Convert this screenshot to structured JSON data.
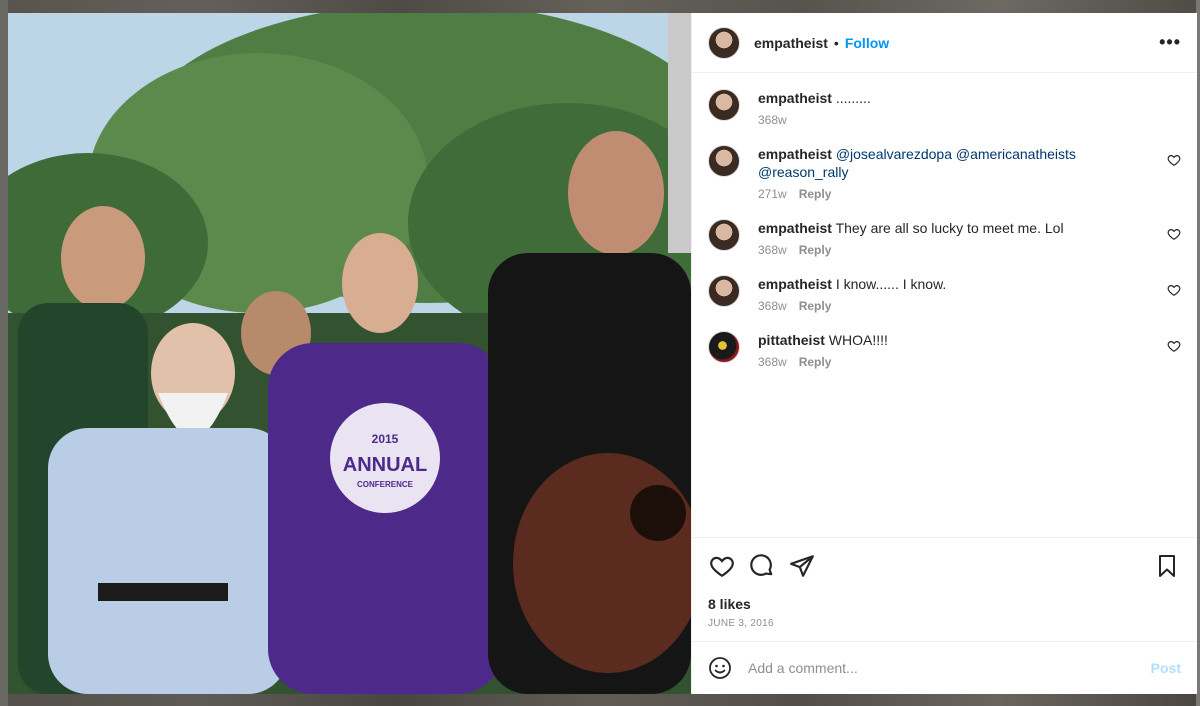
{
  "post": {
    "username": "empatheist",
    "follow_label": "Follow",
    "separator": "•",
    "more_label": "•••",
    "photo_shirt_text_year": "2015",
    "photo_shirt_text_main": "ANNUAL",
    "photo_shirt_text_sub": "CONFERENCE"
  },
  "comments": [
    {
      "user": "empatheist",
      "text": ".........",
      "time": "368w",
      "reply": "",
      "liked": false,
      "avatar": "user"
    },
    {
      "user": "empatheist",
      "text_parts": [
        "@josealvarezdopa",
        "@americanatheists",
        "@reason_rally"
      ],
      "time": "271w",
      "reply": "Reply",
      "avatar": "user"
    },
    {
      "user": "empatheist",
      "text": "They are all so lucky to meet me. Lol",
      "time": "368w",
      "reply": "Reply",
      "avatar": "user"
    },
    {
      "user": "empatheist",
      "text": "I know...... I know.",
      "time": "368w",
      "reply": "Reply",
      "avatar": "user"
    },
    {
      "user": "pittatheist",
      "text": "WHOA!!!!",
      "time": "368w",
      "reply": "Reply",
      "avatar": "alt"
    }
  ],
  "footer": {
    "likes": "8 likes",
    "date": "JUNE 3, 2016",
    "comment_placeholder": "Add a comment...",
    "post_label": "Post"
  },
  "icons": {
    "like": "heart-icon",
    "comment": "comment-icon",
    "share": "share-icon",
    "save": "bookmark-icon",
    "emoji": "emoji-icon",
    "more": "more-icon"
  }
}
